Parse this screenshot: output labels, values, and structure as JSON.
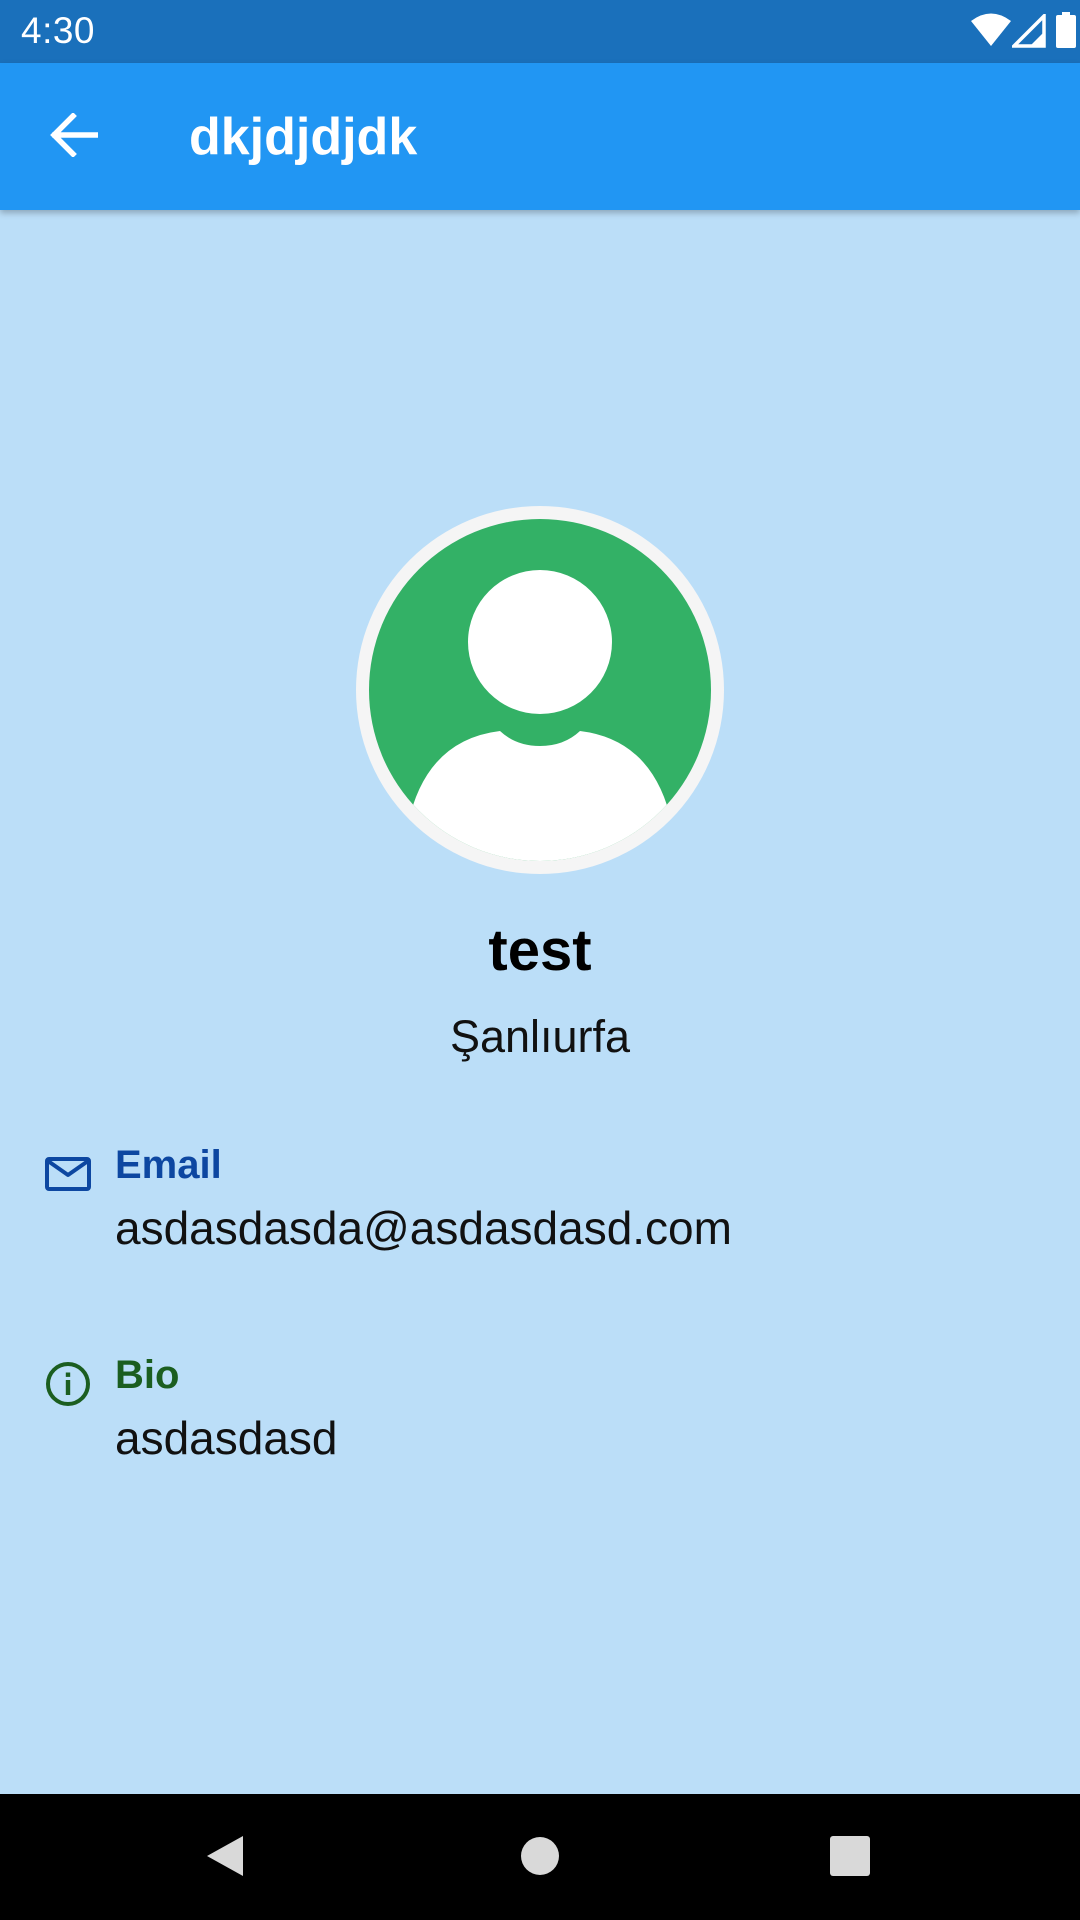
{
  "status_bar": {
    "time": "4:30",
    "icons": [
      "wifi-icon",
      "signal-icon",
      "battery-icon"
    ]
  },
  "app_bar": {
    "title": "dkjdjdjdk",
    "back_icon": "arrow-back-icon"
  },
  "profile": {
    "avatar_icon": "person-icon",
    "name": "test",
    "location": "Şanlıurfa"
  },
  "details": {
    "email": {
      "icon": "mail-icon",
      "label": "Email",
      "value": "asdasdasda@asdasdasd.com"
    },
    "bio": {
      "icon": "info-icon",
      "label": "Bio",
      "value": "asdasdasd"
    }
  },
  "nav_bar": {
    "icons": [
      "nav-back-icon",
      "nav-home-icon",
      "nav-recents-icon"
    ]
  },
  "colors": {
    "status_bar": "#1A70BB",
    "app_bar": "#2196F3",
    "background": "#BBDEF8",
    "avatar_fill": "#33B166",
    "email_accent": "#0D47A1",
    "bio_accent": "#1B5E20"
  }
}
